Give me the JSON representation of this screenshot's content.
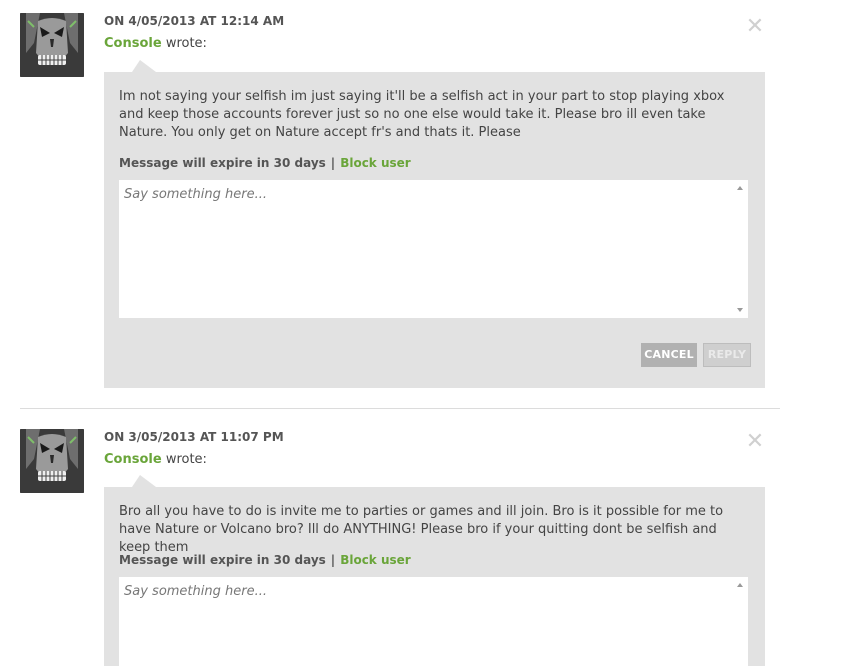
{
  "messages": [
    {
      "date": "ON 4/05/2013 AT 12:14 AM",
      "author": "Console",
      "wrote": "wrote:",
      "close": "✕",
      "body": "Im not saying your selfish im just saying it'll be a selfish act in your part to stop playing xbox and keep those accounts forever just so no one else would take it. Please bro ill even take Nature. You only get on Nature accept fr's and thats it. Please",
      "expire": "Message will expire in 30 days",
      "separator": "|",
      "block": "Block user",
      "reply_placeholder": "Say something here...",
      "cancel_label": "CANCEL",
      "reply_label": "REPLY"
    },
    {
      "date": "ON 3/05/2013 AT 11:07 PM",
      "author": "Console",
      "wrote": "wrote:",
      "close": "✕",
      "body": "Bro all you have to do is invite me to parties or games and ill join. Bro is it possible for me to have Nature or Volcano bro? Ill do ANYTHING! Please bro if your quitting dont be selfish and keep them",
      "expire": "Message will expire in 30 days",
      "separator": "|",
      "block": "Block user",
      "reply_placeholder": "Say something here..."
    }
  ],
  "colors": {
    "accent_green": "#6aa53a",
    "bubble_bg": "#e2e2e2",
    "cancel_bg": "#b1b1b1",
    "reply_bg": "#cfcfcf"
  },
  "icons": {
    "avatar": "skull-avatar-icon",
    "close": "close-icon",
    "scroll_up": "scroll-up-arrow-icon",
    "scroll_down": "scroll-down-arrow-icon"
  }
}
